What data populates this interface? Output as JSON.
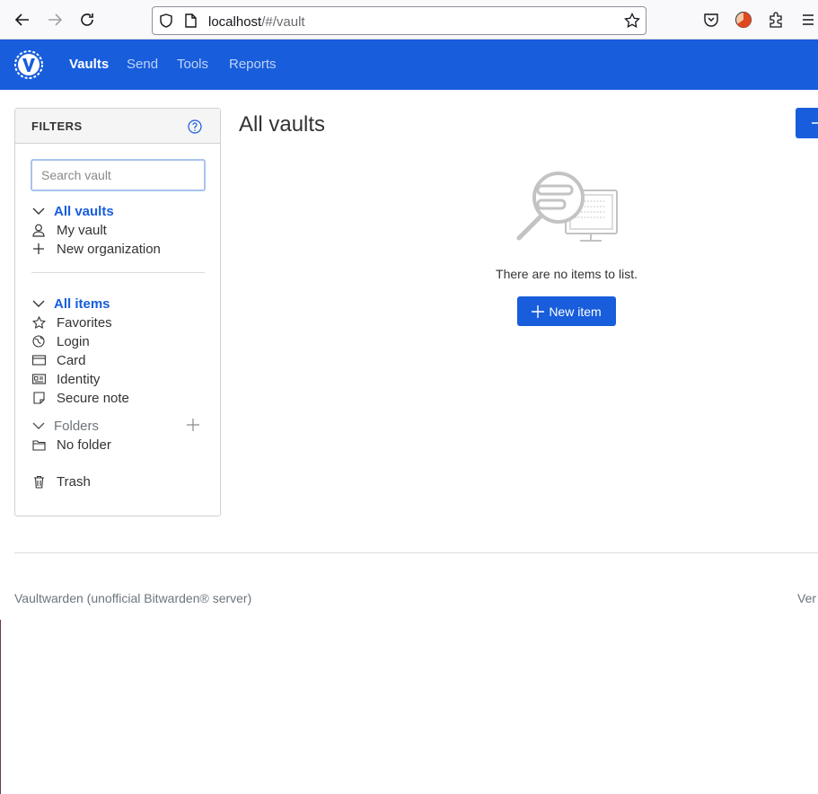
{
  "browser": {
    "url_host": "localhost",
    "url_path": "/#/vault"
  },
  "header": {
    "nav": [
      "Vaults",
      "Send",
      "Tools",
      "Reports"
    ]
  },
  "filters": {
    "title": "FILTERS",
    "search_placeholder": "Search vault",
    "vaults_header": "All vaults",
    "vaults": [
      "My vault",
      "New organization"
    ],
    "items_header": "All items",
    "types": [
      "Favorites",
      "Login",
      "Card",
      "Identity",
      "Secure note"
    ],
    "folders_header": "Folders",
    "folders": [
      "No folder"
    ],
    "trash": "Trash"
  },
  "main": {
    "title": "All vaults",
    "empty_text": "There are no items to list.",
    "new_item_label": "New item"
  },
  "footer": {
    "text": "Vaultwarden (unofficial Bitwarden® server)",
    "version_partial": "Ver"
  },
  "colors": {
    "brand": "#175ddc"
  }
}
